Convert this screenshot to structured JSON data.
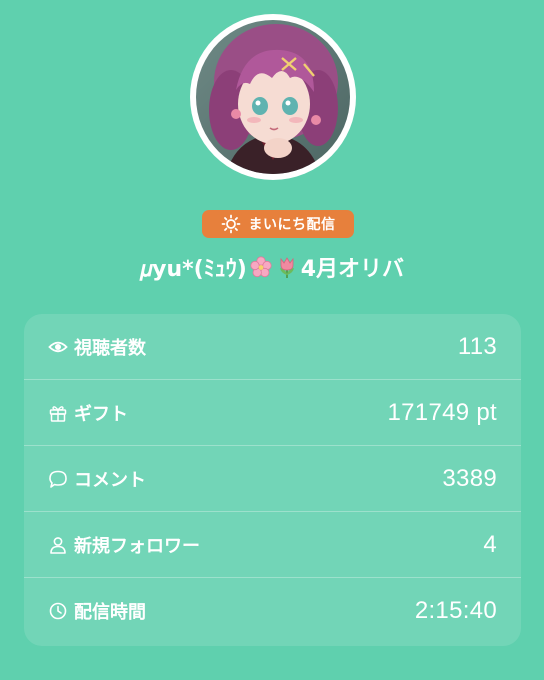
{
  "broadcaster": {
    "badge_label": "まいにち配信",
    "name": "𝜇yu*(ﾐｭｳ)",
    "name_suffix": "4月オリバ",
    "emojis": [
      "sakura-emoji",
      "tulip-emoji"
    ]
  },
  "stats": [
    {
      "icon": "eye-icon",
      "label": "視聴者数",
      "value": "113"
    },
    {
      "icon": "gift-icon",
      "label": "ギフト",
      "value": "171749 pt"
    },
    {
      "icon": "comment-icon",
      "label": "コメント",
      "value": "3389"
    },
    {
      "icon": "person-icon",
      "label": "新規フォロワー",
      "value": "4"
    },
    {
      "icon": "clock-icon",
      "label": "配信時間",
      "value": "2:15:40"
    }
  ],
  "colors": {
    "background": "#5fd0ae",
    "badge": "#e7803c",
    "text": "#ffffff"
  }
}
